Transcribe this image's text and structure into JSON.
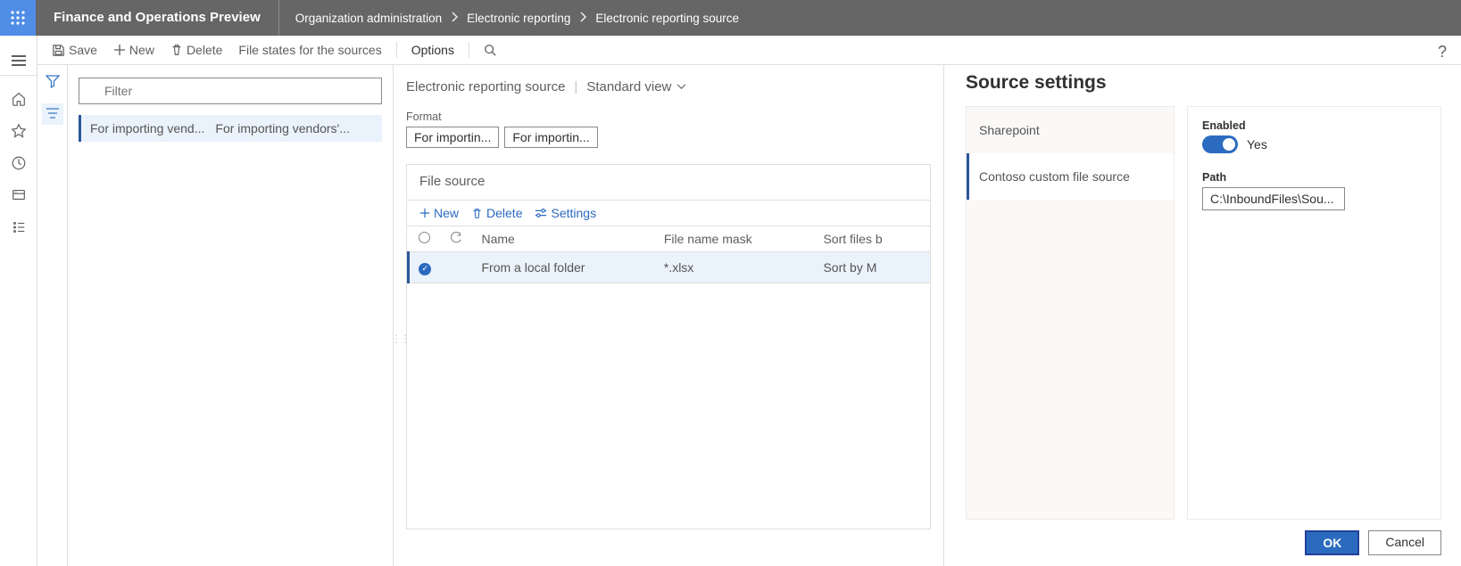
{
  "app": {
    "name": "Finance and Operations Preview"
  },
  "breadcrumbs": [
    "Organization administration",
    "Electronic reporting",
    "Electronic reporting source"
  ],
  "commands": {
    "save": "Save",
    "new": "New",
    "delete": "Delete",
    "file_states": "File states for the sources",
    "options": "Options"
  },
  "filter": {
    "placeholder": "Filter"
  },
  "list": {
    "items": [
      {
        "col1": "For importing vend...",
        "col2": "For importing vendors'..."
      }
    ]
  },
  "page": {
    "title": "Electronic reporting source",
    "view_label": "Standard view",
    "format_label": "Format",
    "format_values": [
      "For importin...",
      "For importin..."
    ]
  },
  "file_source": {
    "title": "File source",
    "cmd_new": "New",
    "cmd_delete": "Delete",
    "cmd_settings": "Settings",
    "columns": {
      "name": "Name",
      "mask": "File name mask",
      "sort": "Sort files b"
    },
    "rows": [
      {
        "name": "From a local folder",
        "mask": "*.xlsx",
        "sort": "Sort by M"
      }
    ]
  },
  "flyout": {
    "title": "Source settings",
    "tabs": [
      "Sharepoint",
      "Contoso custom file source"
    ],
    "enabled_label": "Enabled",
    "enabled_value": "Yes",
    "path_label": "Path",
    "path_value": "C:\\InboundFiles\\Sou...",
    "ok": "OK",
    "cancel": "Cancel"
  }
}
